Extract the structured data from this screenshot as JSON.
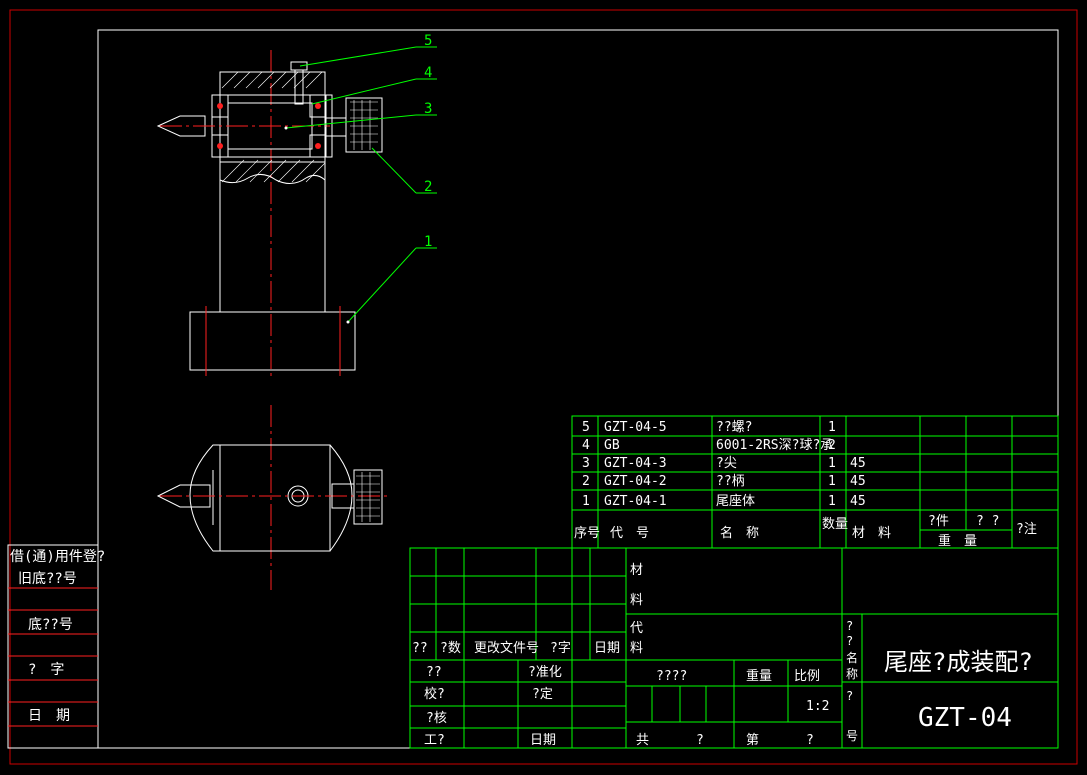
{
  "drawing": {
    "title": "尾座?成装配?",
    "code": "GZT-04",
    "scale": "1:2",
    "balloons": [
      "5",
      "4",
      "3",
      "2",
      "1"
    ]
  },
  "bom": {
    "header": {
      "seq": "序号",
      "code": "代　号",
      "name": "名　称",
      "qty": "数量",
      "material": "材　料",
      "single": "?件",
      "total": "? ?",
      "weight": "重　量",
      "remark": "?注"
    },
    "rows": [
      {
        "seq": "5",
        "code": "GZT-04-5",
        "name": "??螺?",
        "qty": "1",
        "material": ""
      },
      {
        "seq": "4",
        "code": "GB",
        "name": "6001-2RS深?球?承",
        "qty": "2",
        "material": ""
      },
      {
        "seq": "3",
        "code": "GZT-04-3",
        "name": "?尖",
        "qty": "1",
        "material": "45"
      },
      {
        "seq": "2",
        "code": "GZT-04-2",
        "name": "??柄",
        "qty": "1",
        "material": "45"
      },
      {
        "seq": "1",
        "code": "GZT-04-1",
        "name": "尾座体",
        "qty": "1",
        "material": "45"
      }
    ]
  },
  "titleblock": {
    "mark": "??",
    "count": "?数",
    "change_doc": "更改文件号",
    "sign": "?字",
    "date": "日期",
    "design": "??",
    "check": "校?",
    "review": "?核",
    "craft": "工?",
    "standard": "?准化",
    "approve": "?定",
    "date2": "日期",
    "material_label": "材料",
    "code_label": "代料",
    "stage": "????",
    "weight": "重量",
    "ratio": "比例",
    "total": "共",
    "total_suffix": "?",
    "sheet": "第",
    "sheet_suffix": "?",
    "name_label": "? ? 名 称",
    "code_label2": "? 号"
  },
  "sidebox": {
    "line1": "借(通)用件登?",
    "line2": "旧底??号",
    "line3": "底??号",
    "line4": "?　字",
    "line5": "日　期"
  }
}
